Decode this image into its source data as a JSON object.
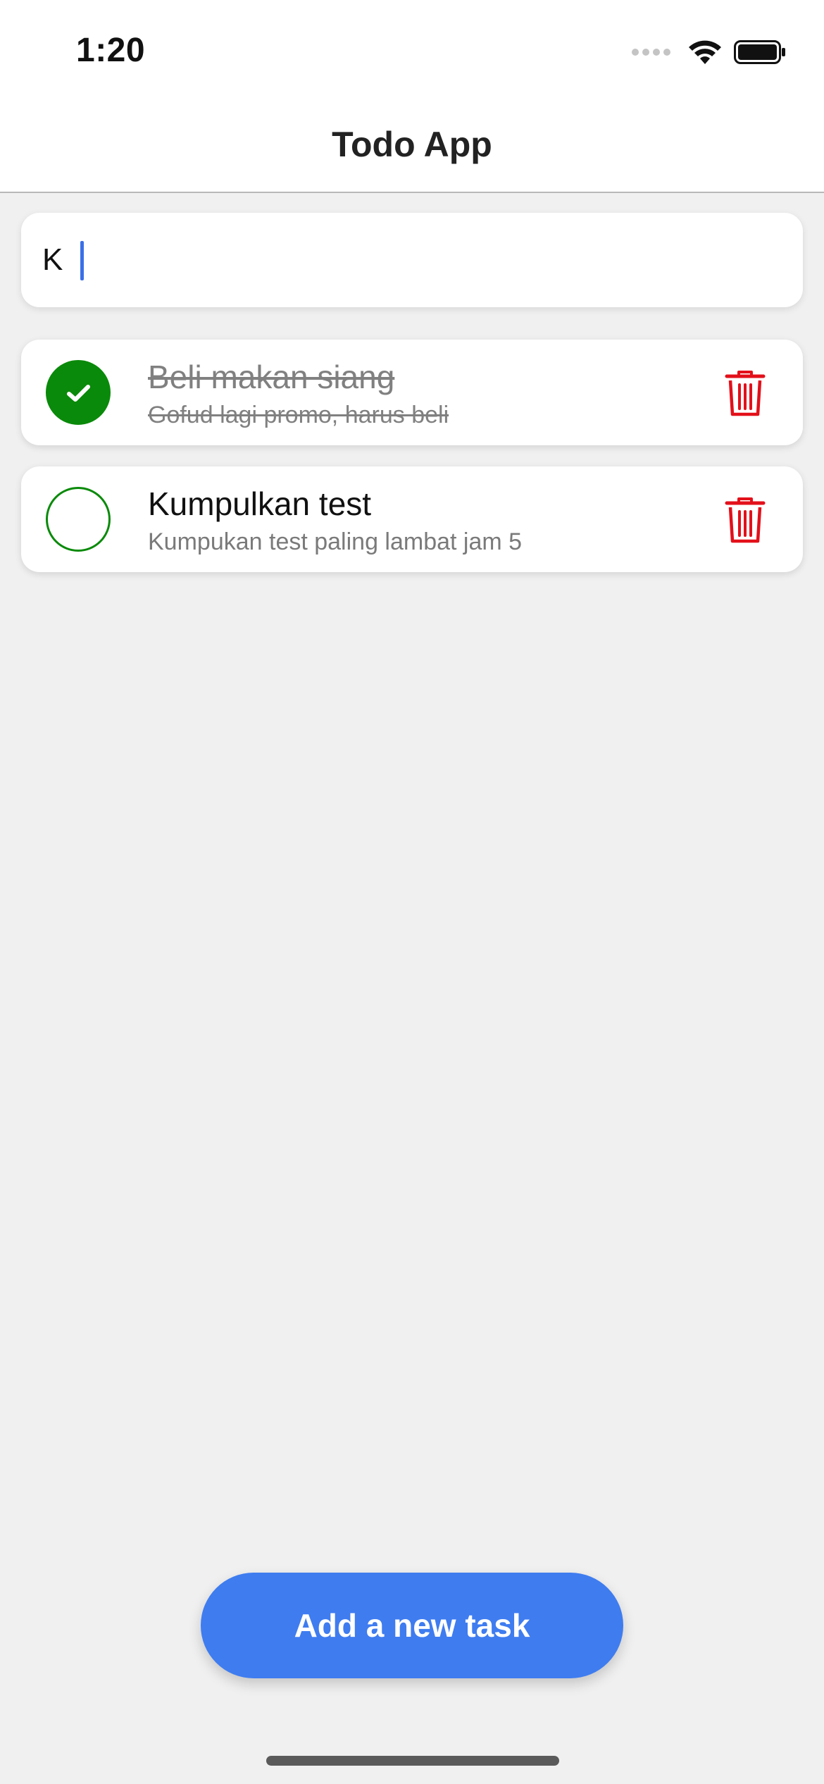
{
  "status_bar": {
    "time": "1:20",
    "icons": [
      "cellular-signal-icon",
      "wifi-icon",
      "battery-icon"
    ]
  },
  "nav": {
    "title": "Todo App"
  },
  "search": {
    "value": "K"
  },
  "tasks": [
    {
      "title": "Beli makan siang",
      "subtitle": "Gofud lagi promo, harus beli",
      "completed": true
    },
    {
      "title": "Kumpulkan test",
      "subtitle": "Kumpukan test paling lambat jam 5",
      "completed": false
    }
  ],
  "add_button": {
    "label": "Add a new task"
  },
  "colors": {
    "accent_blue": "#3e7cf0",
    "complete_green": "#0a8a0a",
    "delete_red": "#e3101a",
    "background": "#f0f0f0"
  }
}
